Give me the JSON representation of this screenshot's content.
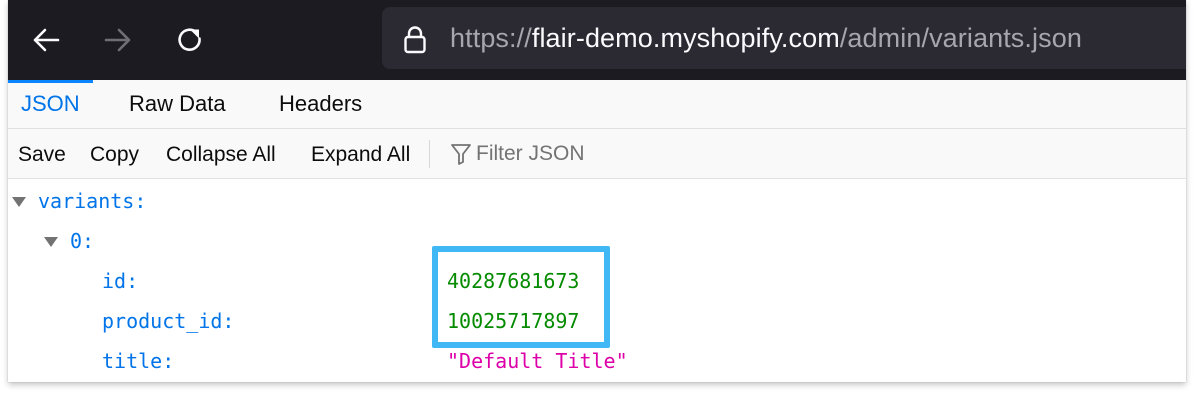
{
  "browser": {
    "nav": {
      "back_icon": "arrow-left-icon",
      "forward_icon": "arrow-right-icon",
      "reload_icon": "reload-icon"
    },
    "url": {
      "lock_icon": "lock-icon",
      "scheme": "https://",
      "host": "flair-demo.myshopify.com",
      "path": "/admin/variants.json"
    }
  },
  "viewer": {
    "tabs": [
      {
        "label": "JSON",
        "active": true
      },
      {
        "label": "Raw Data",
        "active": false
      },
      {
        "label": "Headers",
        "active": false
      }
    ],
    "toolbar": {
      "save": "Save",
      "copy": "Copy",
      "collapse_all": "Collapse All",
      "expand_all": "Expand All",
      "filter_icon": "filter-icon",
      "filter_placeholder": "Filter JSON",
      "filter_value": ""
    }
  },
  "tree": {
    "root_key": "variants:",
    "item_key": "0:",
    "fields": [
      {
        "key": "id:",
        "value": "40287681673",
        "type": "number",
        "highlighted": true
      },
      {
        "key": "product_id:",
        "value": "10025717897",
        "type": "number",
        "highlighted": true
      },
      {
        "key": "title:",
        "value": "\"Default Title\"",
        "type": "string",
        "highlighted": false
      }
    ]
  },
  "colors": {
    "toolbar_bg": "#1c1b22",
    "urlbar_bg": "#2b2a33",
    "key": "#0074e8",
    "number": "#058b00",
    "string": "#dd00a9",
    "highlight": "#3fb8f5",
    "active_tab": "#0074e8"
  }
}
